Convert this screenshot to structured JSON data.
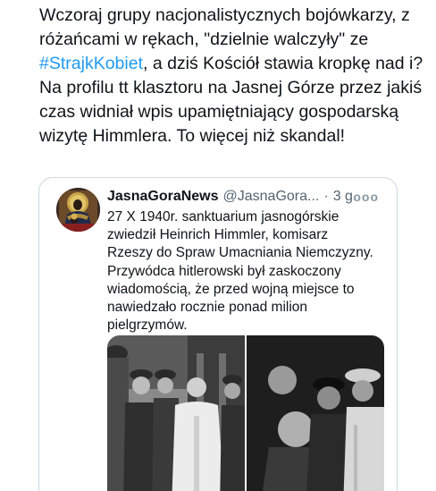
{
  "tweet": {
    "text_before": "Wczoraj grupy nacjonalistycznych bojówkarzy, z różańcami w rękach, \"dzielnie walczyły\" ze ",
    "hashtag": "#StrajkKobiet",
    "text_after": ", a dziś Kościół stawia kropkę nad i? Na profilu tt klasztoru na Jasnej Górze przez jakiś czas widniał wpis upamiętniający gospodarską wizytę Himmlera. To więcej niż skandal!"
  },
  "quoted_tweet": {
    "name": "JasnaGoraNews",
    "handle": "@JasnaGora...",
    "separator": "·",
    "time": "3 g.",
    "more": "ooo",
    "body": "27 X 1940r. sanktuarium jasnogórskie zwiedził Heinrich Himmler, komisarz Rzeszy do Spraw Umacniania Niemczyzny. Przywódca hitlerowski był zaskoczony wiadomością, że przed wojną miejsce to nawiedzało rocznie ponad milion pielgrzymów.",
    "avatar_icon": "madonna-icon",
    "photos": [
      "historical-photo-monk-and-soldiers",
      "historical-photo-officers"
    ]
  },
  "colors": {
    "link": "#1d9bf0",
    "text": "#0f1419",
    "muted": "#536471",
    "border": "#cfd9de"
  }
}
